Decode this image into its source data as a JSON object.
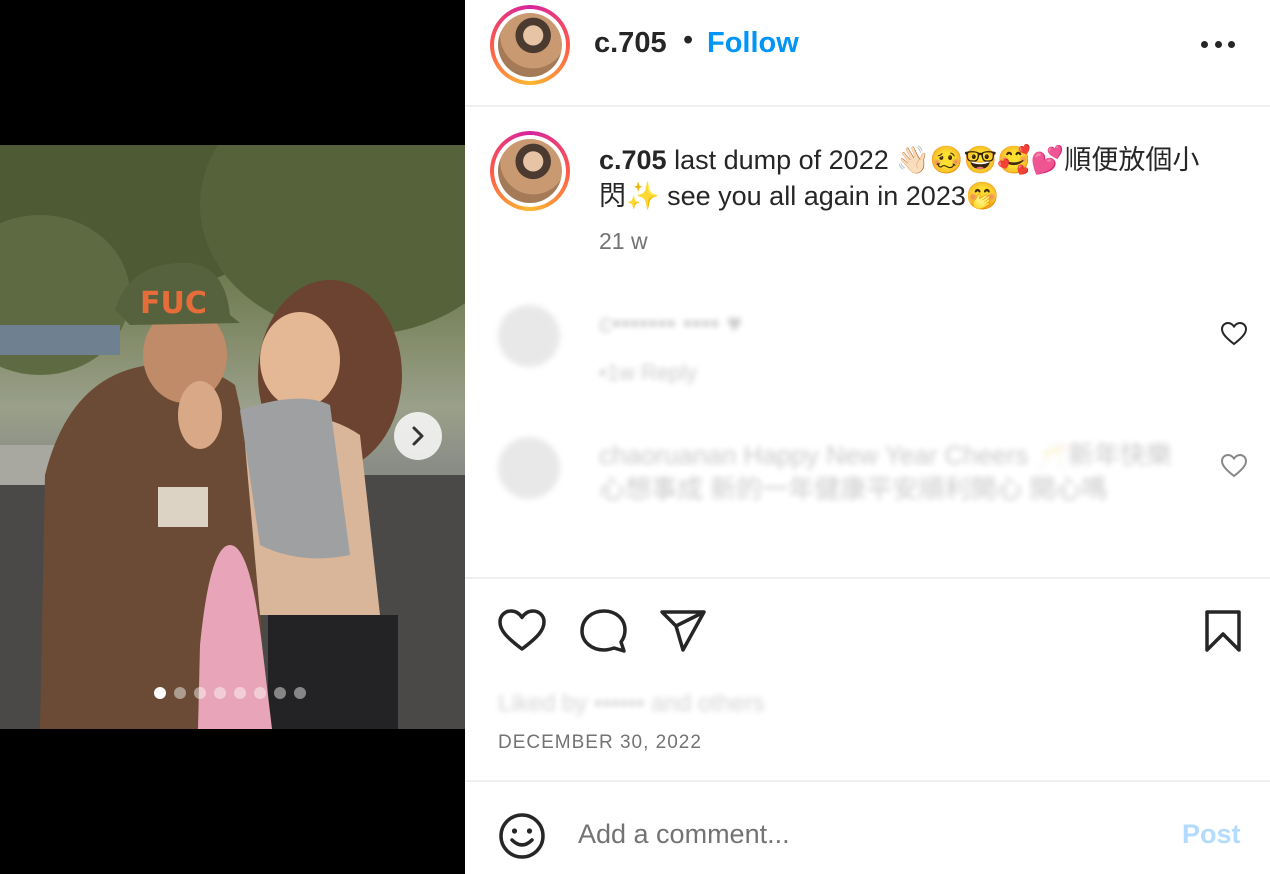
{
  "post": {
    "username": "c.705",
    "separator": "•",
    "follow_label": "Follow",
    "caption_username": "c.705",
    "caption_text": " last dump of 2022 👋🏻🥴🤓🥰💕順便放個小閃✨ see you all again in 2023🤭",
    "age": "21 w",
    "date": "DECEMBER 30, 2022"
  },
  "comments": [
    {
      "text": "c••••••• •••• ♥",
      "meta": "•1w  Reply"
    },
    {
      "text": "chaoruanan Happy New Year Cheers 🥂新年快樂 心想事成 新的一年健康平安順利開心 開心嗎",
      "meta": ""
    }
  ],
  "liked_by": "Liked by ••••••  and others",
  "comment_box": {
    "placeholder": "Add a comment...",
    "post_label": "Post"
  },
  "carousel": {
    "total_slides": 8,
    "active_slide": 1
  },
  "icons": {
    "more": "more-options-icon",
    "like": "heart-icon",
    "comment": "comment-icon",
    "share": "share-icon",
    "save": "bookmark-icon",
    "emoji": "emoji-icon",
    "next": "chevron-right-icon"
  }
}
